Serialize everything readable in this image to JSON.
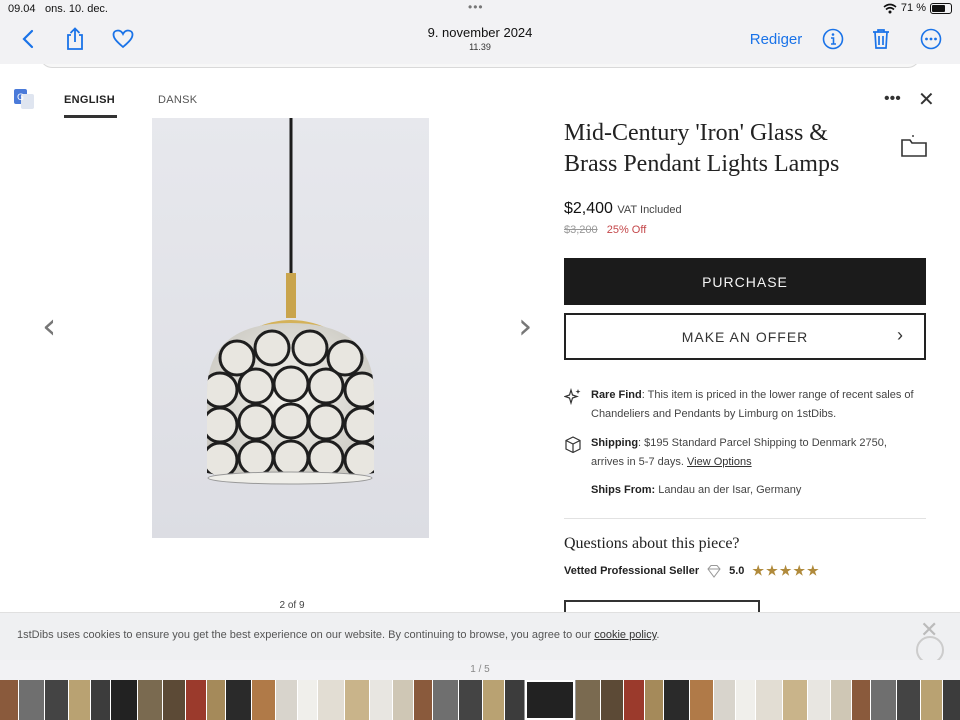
{
  "status_bar": {
    "time": "09.04",
    "date": "ons. 10. dec.",
    "battery_text": "71 %",
    "battery_level": 0.71
  },
  "photos_toolbar": {
    "title_date": "9. november 2024",
    "title_time": "11.39",
    "edit_label": "Rediger",
    "icons": [
      "back-chevron-icon",
      "share-icon",
      "heart-icon",
      "info-icon",
      "trash-icon",
      "more-icon"
    ]
  },
  "translate_bar": {
    "lang_active": "ENGLISH",
    "lang_other": "DANSK",
    "more": "•••",
    "close": "✕"
  },
  "product": {
    "title": "Mid-Century 'Iron' Glass & Brass Pendant Lights Lamps",
    "price": "$2,400",
    "vat": "VAT Included",
    "old_price": "$3,200",
    "discount": "25% Off",
    "purchase_label": "PURCHASE",
    "offer_label": "MAKE AN OFFER",
    "image_counter": "2 of 9",
    "rare_find_label": "Rare Find",
    "rare_find_text": ": This item is priced in the lower range of recent sales of Chandeliers and Pendants by Limburg on 1stDibs.",
    "shipping_label": "Shipping",
    "shipping_text": ": $195 Standard Parcel Shipping to Denmark 2750, arrives in 5-7 days.",
    "shipping_link": "View Options",
    "ships_from_label": "Ships From:",
    "ships_from_value": "Landau an der Isar, Germany",
    "questions_title": "Questions about this piece?",
    "seller_label": "Vetted Professional Seller",
    "seller_rating": "5.0",
    "stars": "★★★★★"
  },
  "cookie_banner": {
    "message": "1stDibs uses cookies to ensure you get the best experience on our website. By continuing to browse, you agree to our ",
    "policy_link": "cookie policy",
    "end": "."
  },
  "pager": "1 / 5",
  "colors": {
    "ios_blue": "#1a73e8",
    "purchase_bg": "#1b1b1b",
    "discount_red": "#c4474a",
    "star_gold": "#b08a3b"
  }
}
